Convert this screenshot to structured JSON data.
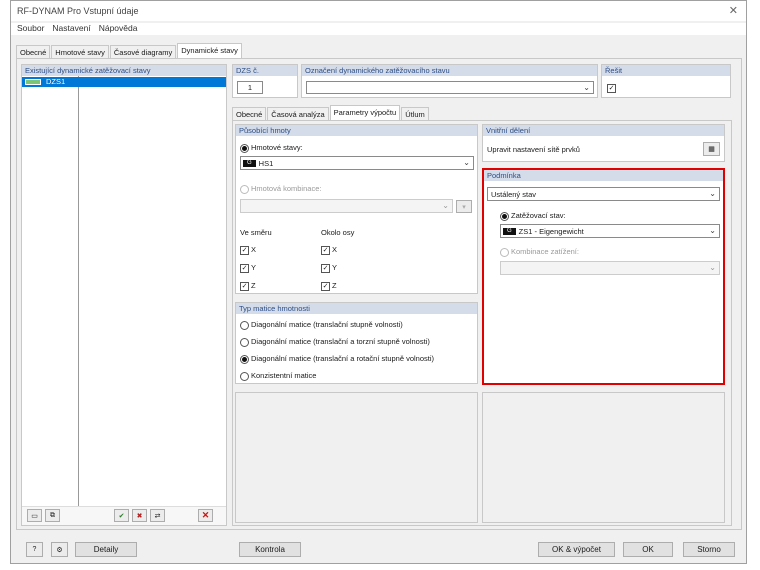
{
  "title": "RF-DYNAM Pro Vstupní údaje",
  "menu": [
    "Soubor",
    "Nastavení",
    "Nápověda"
  ],
  "main_tabs": [
    "Obecné",
    "Hmotové stavy",
    "Časové diagramy",
    "Dynamické stavy"
  ],
  "left_panel": {
    "header": "Existující dynamické zatěžovací stavy",
    "items": [
      {
        "id": "DZS1",
        "color": "#7cc576"
      }
    ]
  },
  "dzs": {
    "label": "DZS č.",
    "value": "1"
  },
  "designation": {
    "label": "Označení dynamického zatěžovacího stavu",
    "value": ""
  },
  "solve": {
    "label": "Řešit",
    "checked": true
  },
  "sub_tabs": [
    "Obecné",
    "Časová analýza",
    "Parametry výpočtu",
    "Útlum"
  ],
  "masses": {
    "header": "Působící hmoty",
    "mass_cases_label": "Hmotové stavy:",
    "mass_case_badge": "G",
    "mass_case_value": "HS1",
    "mass_combo_label": "Hmotová kombinace:",
    "direction_label": "Ve směru",
    "axis_label": "Okolo osy",
    "directions": [
      "X",
      "Y",
      "Z"
    ]
  },
  "matrix": {
    "header": "Typ matice hmotnosti",
    "options": [
      "Diagonální matice (translační stupně volnosti)",
      "Diagonální matice (translační a torzní stupně volnosti)",
      "Diagonální matice (translační a rotační stupně volnosti)",
      "Konzistentní matice"
    ],
    "selected_index": 2
  },
  "mesh": {
    "header": "Vnitřní dělení",
    "text": "Upravit nastavení sítě prvků"
  },
  "condition": {
    "header": "Podmínka",
    "mode": "Ustálený stav",
    "load_case_label": "Zatěžovací stav:",
    "load_case_badge": "G",
    "load_case_value": "ZS1 - Eigengewicht",
    "load_combo_label": "Kombinace zatížení:",
    "highlight_color": "#e00000"
  },
  "footer": {
    "details": "Detaily",
    "check": "Kontrola",
    "ok_calc": "OK & výpočet",
    "ok": "OK",
    "cancel": "Storno"
  }
}
